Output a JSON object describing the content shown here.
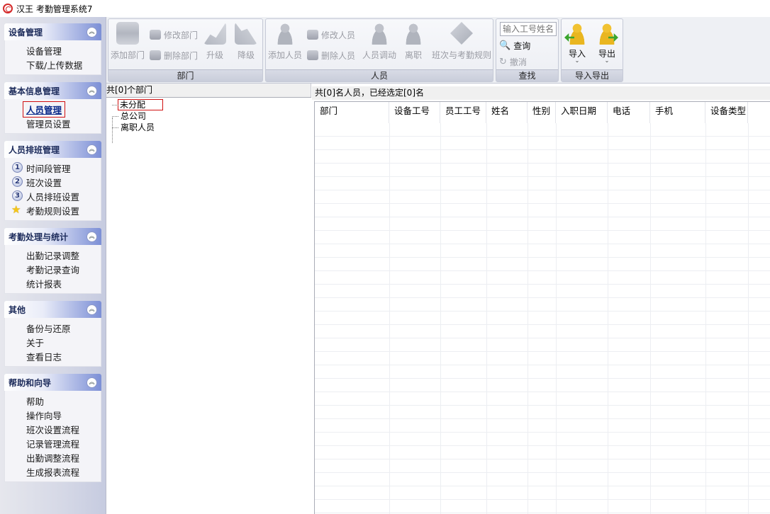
{
  "app": {
    "title": "汉王 考勤管理系统7"
  },
  "sidebar": {
    "groups": [
      {
        "title": "设备管理",
        "items": [
          "设备管理",
          "下载/上传数据"
        ]
      },
      {
        "title": "基本信息管理",
        "items": [
          "人员管理",
          "管理员设置"
        ]
      },
      {
        "title": "人员排班管理",
        "items": [
          "时间段管理",
          "班次设置",
          "人员排班设置",
          "考勤规则设置"
        ],
        "badges": [
          "1",
          "2",
          "3",
          "star"
        ]
      },
      {
        "title": "考勤处理与统计",
        "items": [
          "出勤记录调整",
          "考勤记录查询",
          "统计报表"
        ]
      },
      {
        "title": "其他",
        "items": [
          "备份与还原",
          "关于",
          "查看日志"
        ]
      },
      {
        "title": "帮助和向导",
        "items": [
          "帮助",
          "操作向导",
          "班次设置流程",
          "记录管理流程",
          "出勤调整流程",
          "生成报表流程"
        ]
      }
    ],
    "selected_item": "人员管理"
  },
  "toolbar": {
    "dept": {
      "label": "部门",
      "add": "添加部门",
      "edit": "修改部门",
      "delete": "删除部门",
      "upgrade": "升级",
      "downgrade": "降级"
    },
    "people": {
      "label": "人员",
      "add": "添加人员",
      "edit": "修改人员",
      "delete": "删除人员",
      "transfer": "人员调动",
      "leave": "离职",
      "shift_rules": "班次与考勤规则"
    },
    "search": {
      "label": "查找",
      "placeholder": "输入工号姓名",
      "query": "查询",
      "cancel": "撤消"
    },
    "io": {
      "label": "导入导出",
      "import": "导入",
      "export": "导出"
    }
  },
  "dept_pane": {
    "summary": "共[0]个部门",
    "tree": [
      "未分配",
      "总公司",
      "离职人员"
    ],
    "selected": "未分配"
  },
  "people_pane": {
    "summary": "共[0]名人员，已经选定[0]名",
    "columns": [
      "部门",
      "设备工号",
      "员工工号",
      "姓名",
      "性别",
      "入职日期",
      "电话",
      "手机",
      "设备类型"
    ],
    "rows": []
  },
  "colors": {
    "accent_red": "#d01010",
    "group_header": "#7c8fd6",
    "import_green": "#3aa52e",
    "import_yellow": "#f1c232"
  }
}
